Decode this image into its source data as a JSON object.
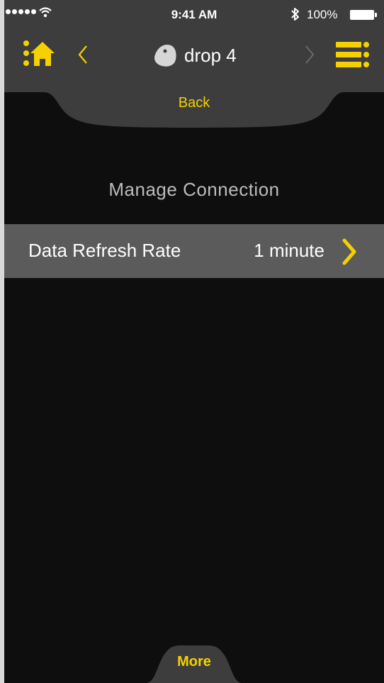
{
  "status_bar": {
    "time": "9:41 AM",
    "battery_percent": "100%",
    "signal_icon": "signal-dots-icon",
    "wifi_icon": "wifi-icon",
    "bluetooth_icon": "bluetooth-icon",
    "battery_icon": "battery-icon"
  },
  "nav": {
    "home_icon": "home-icon",
    "back_icon": "chevron-left-icon",
    "device_icon": "drop-icon",
    "title": "drop 4",
    "forward_icon": "chevron-right-icon",
    "menu_icon": "list-menu-icon"
  },
  "back_tab": {
    "label": "Back"
  },
  "section": {
    "title": "Manage Connection"
  },
  "settings": [
    {
      "label": "Data Refresh Rate",
      "value": "1 minute",
      "icon": "chevron-right-icon"
    }
  ],
  "more_tab": {
    "label": "More"
  },
  "colors": {
    "accent": "#f5d100",
    "bar": "#3d3d3d",
    "background": "#0e0e0e",
    "row": "#5b5b5b",
    "muted_text": "#bcbcbc"
  }
}
